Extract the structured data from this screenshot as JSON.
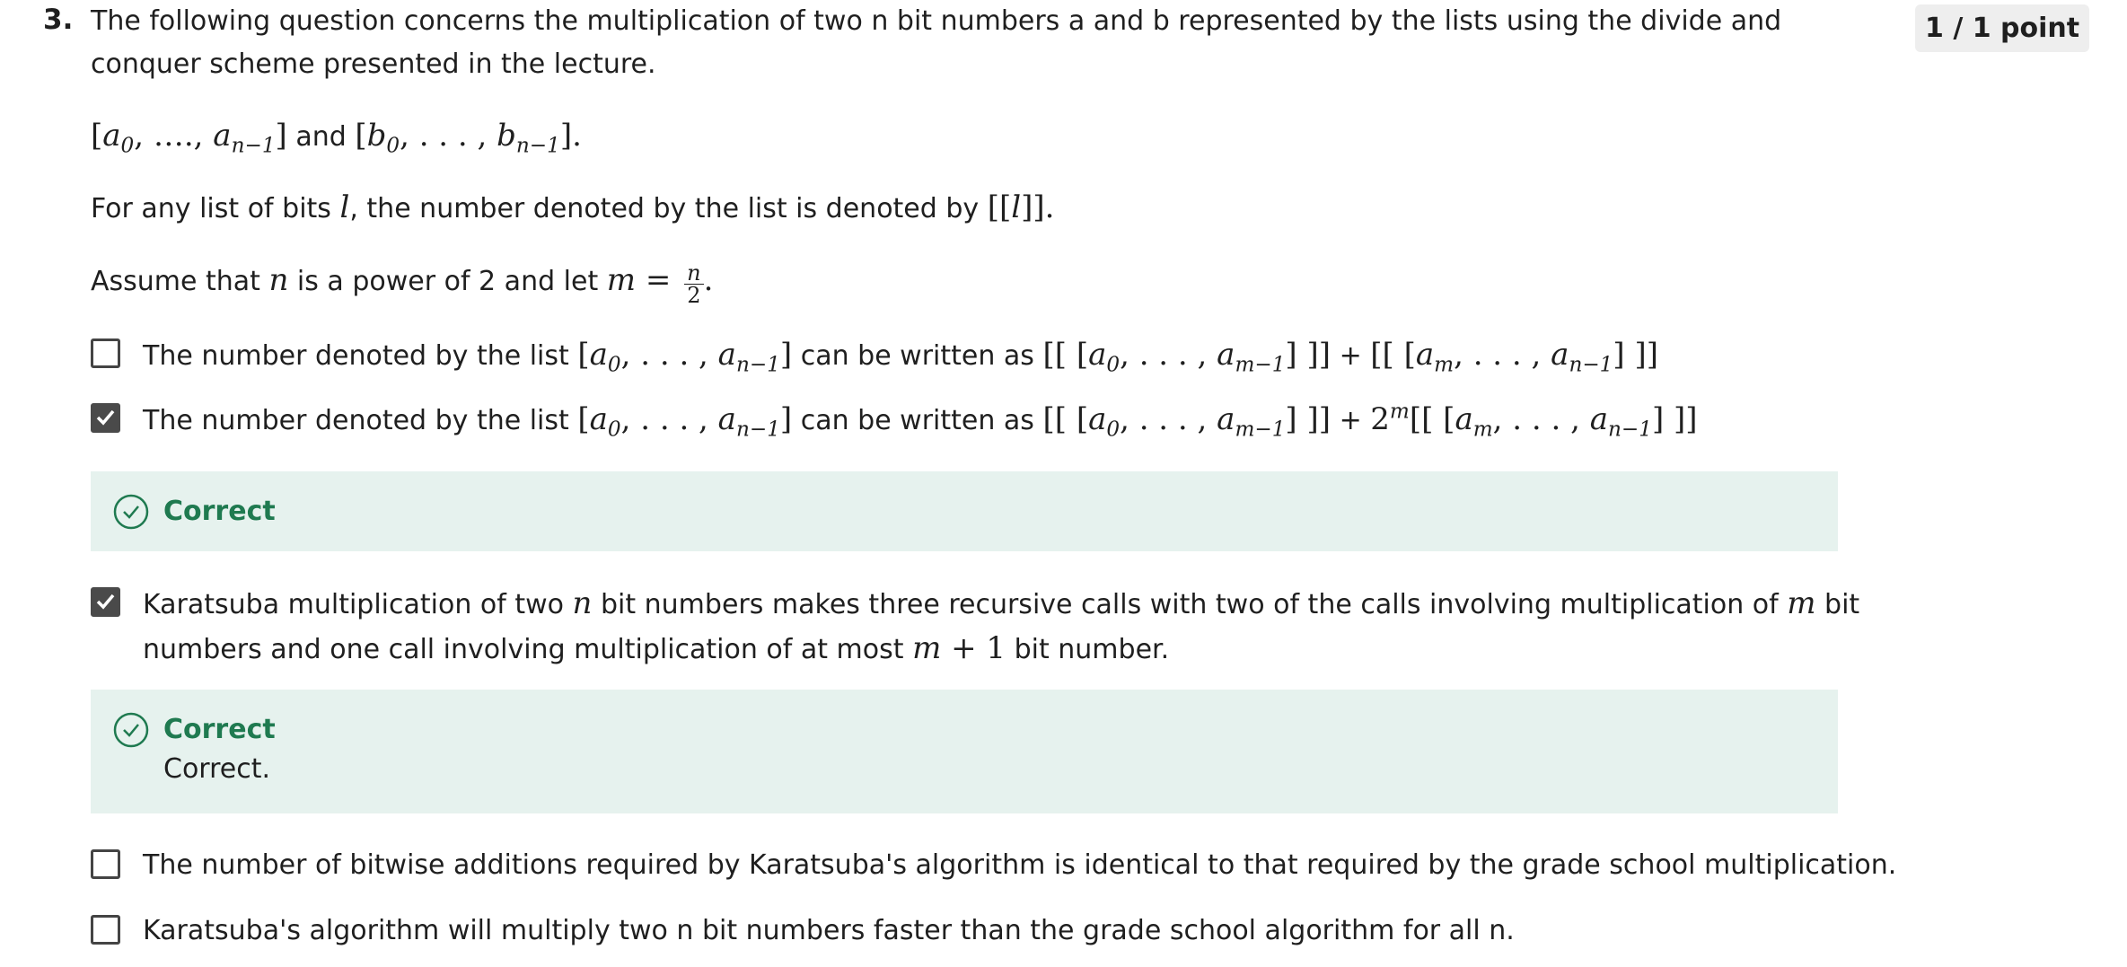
{
  "question": {
    "number": "3.",
    "points": "1 / 1 point",
    "intro": "The following question concerns the multiplication of two n bit numbers a and b represented by the lists using the divide and conquer scheme presented in the lecture.",
    "and_word": "and",
    "bits_text_1": "For any list of bits ",
    "bits_text_2": ", the number denoted by the list is denoted by ",
    "assume_text_1": "Assume that ",
    "assume_text_2": " is a power of 2 and let "
  },
  "options": [
    {
      "prefix": "The number denoted by the list",
      "middle": "can be written as",
      "operator": "+",
      "checked": false
    },
    {
      "prefix": "The number denoted by the list",
      "middle": "can be written as",
      "operator": "+",
      "checked": true,
      "feedback": {
        "label": "Correct",
        "text": ""
      }
    },
    {
      "text_1": "Karatsuba multiplication of two ",
      "text_2": " bit numbers makes three recursive calls with two of the calls involving multiplication of ",
      "text_3": " bit numbers and one call involving multiplication of at most ",
      "text_4": " bit number.",
      "checked": true,
      "feedback": {
        "label": "Correct",
        "text": "Correct."
      }
    },
    {
      "text": "The number of bitwise additions required by Karatsuba's algorithm is identical to that required by the grade school multiplication.",
      "checked": false
    },
    {
      "text": "Karatsuba's algorithm will multiply two n bit numbers faster than the grade school algorithm for all n.",
      "checked": false
    }
  ],
  "colors": {
    "correct_bg": "#e6f2ee",
    "correct_text": "#1f7a50",
    "checkbox_checked": "#4a4a4a"
  }
}
